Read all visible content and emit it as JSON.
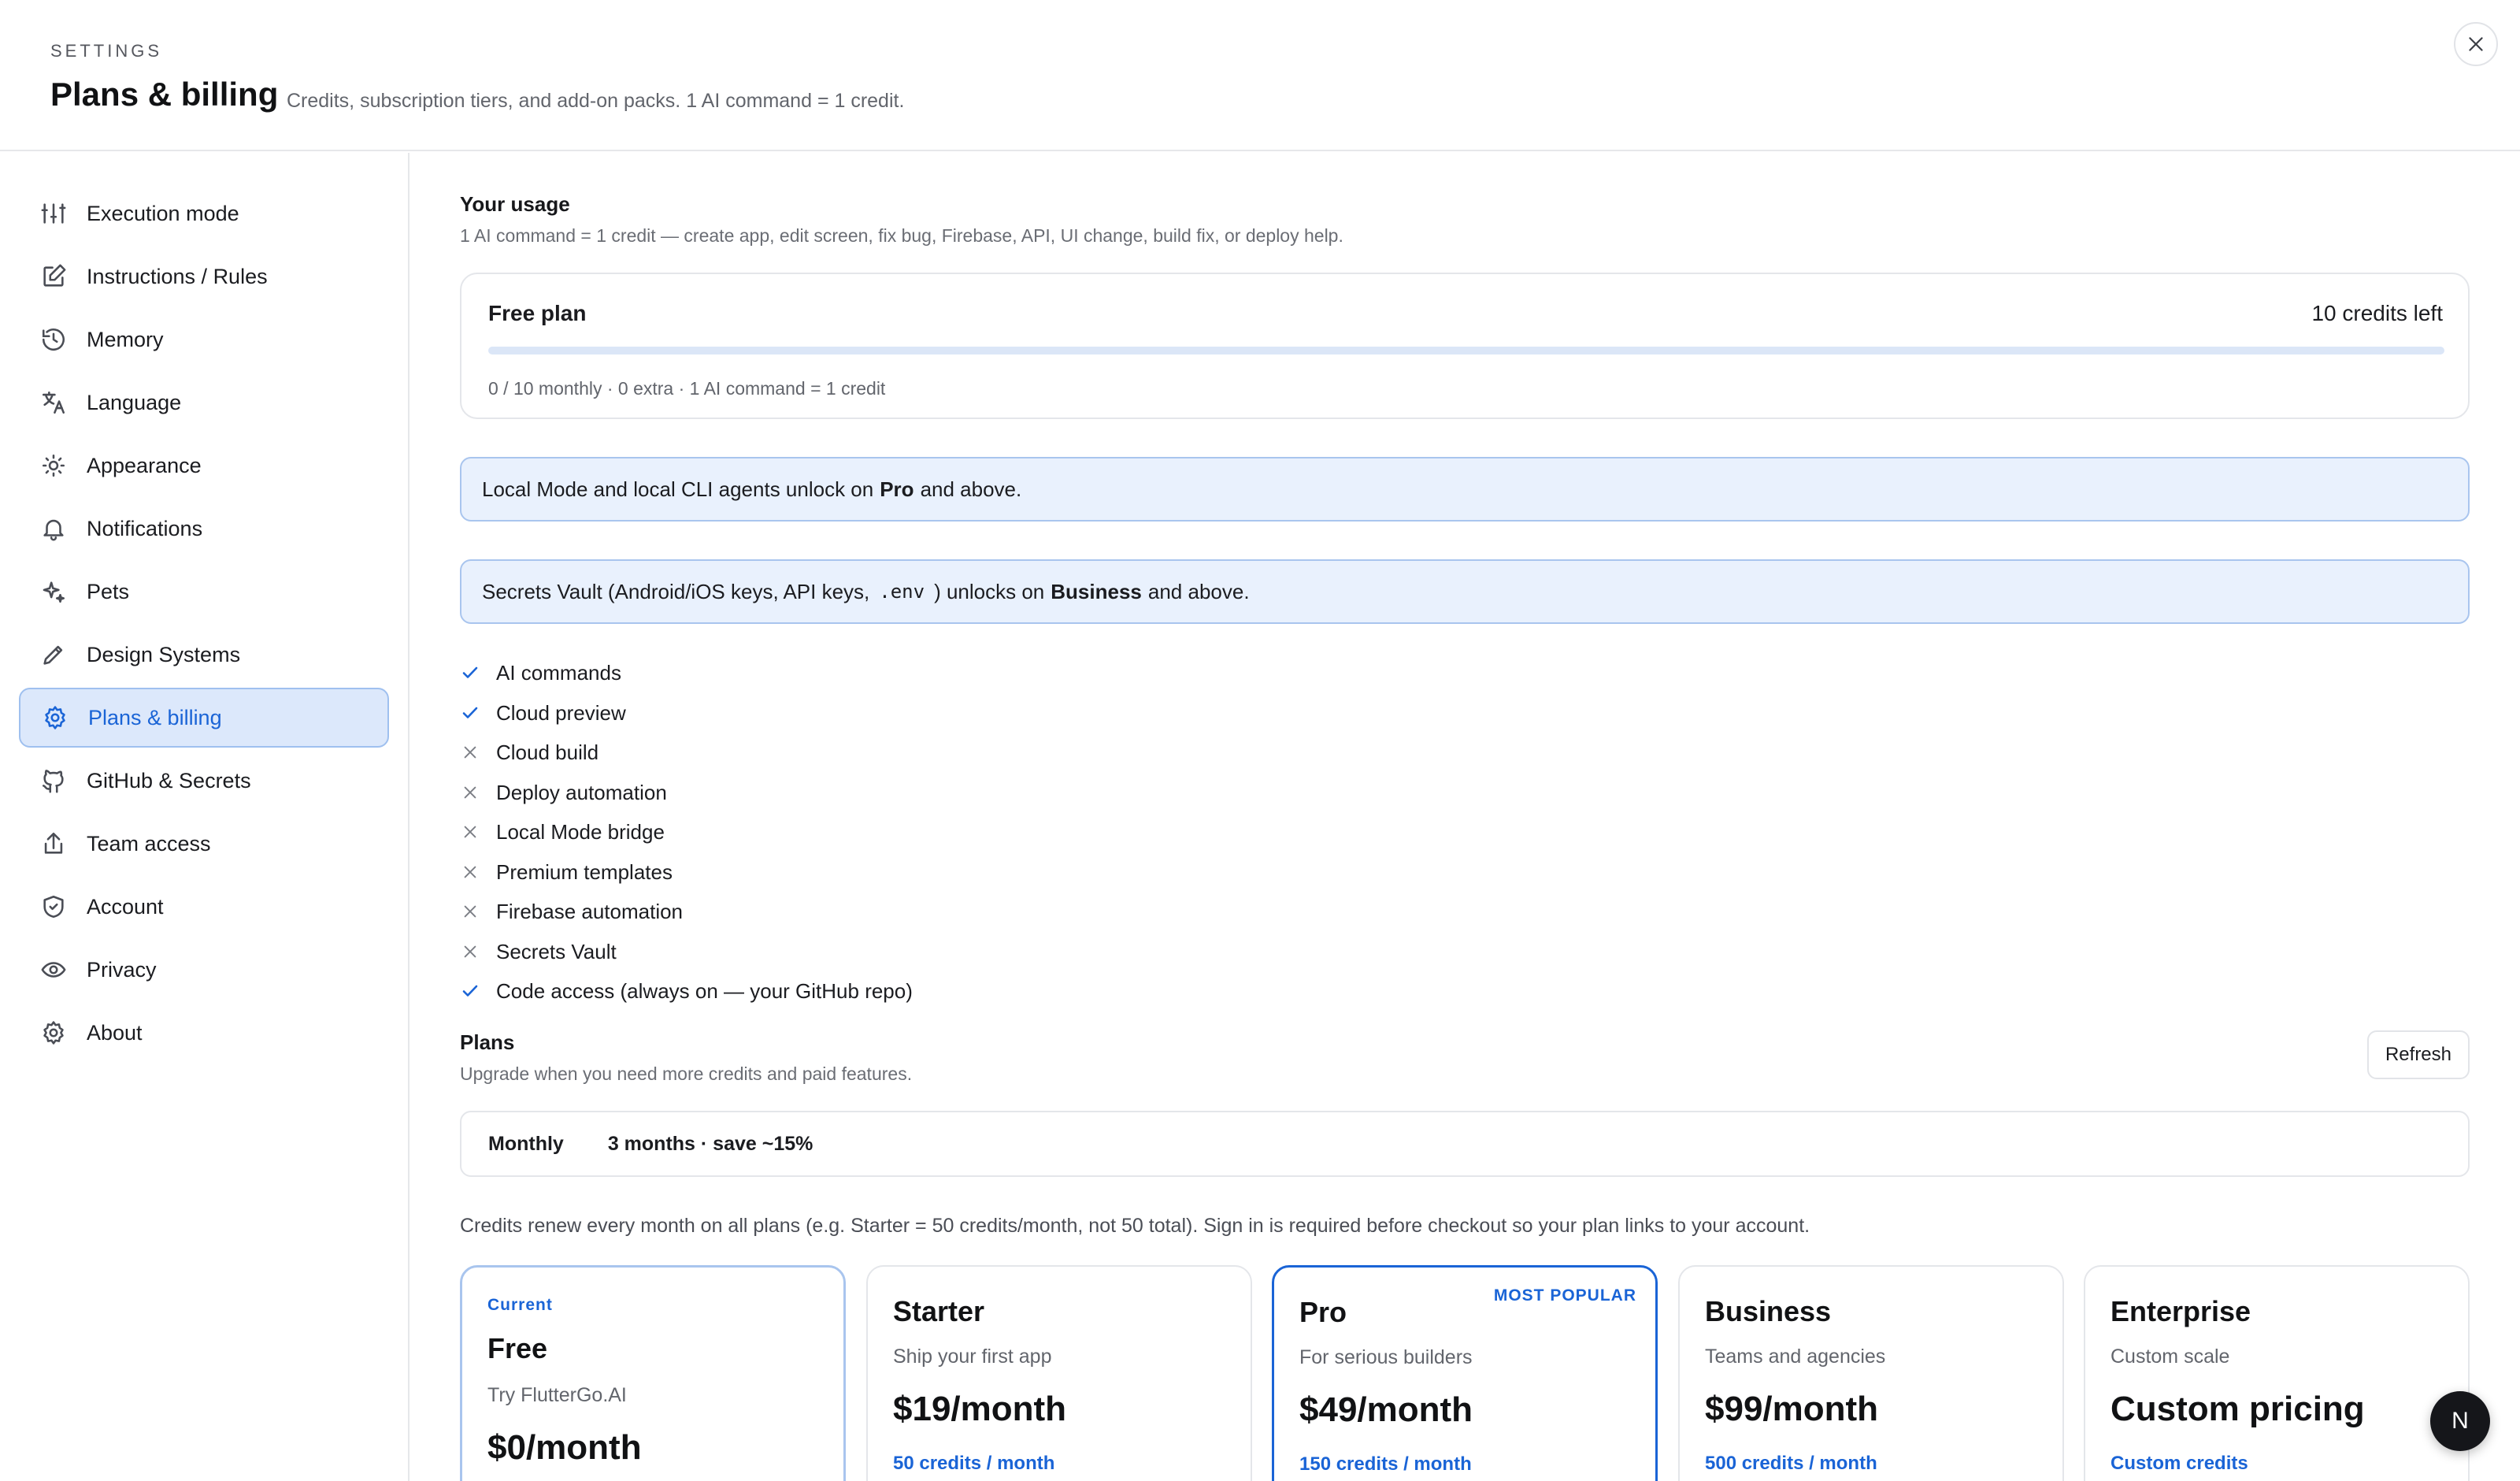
{
  "header": {
    "eyebrow": "SETTINGS",
    "title": "Plans & billing",
    "subtitle": "Credits, subscription tiers, and add-on packs. 1 AI command = 1 credit."
  },
  "sidebar": {
    "items": [
      {
        "label": "Execution mode",
        "icon": "sliders-icon"
      },
      {
        "label": "Instructions / Rules",
        "icon": "edit-icon"
      },
      {
        "label": "Memory",
        "icon": "history-icon"
      },
      {
        "label": "Language",
        "icon": "translate-icon"
      },
      {
        "label": "Appearance",
        "icon": "sun-icon"
      },
      {
        "label": "Notifications",
        "icon": "bell-icon"
      },
      {
        "label": "Pets",
        "icon": "sparkle-icon"
      },
      {
        "label": "Design Systems",
        "icon": "pencil-icon"
      },
      {
        "label": "Plans & billing",
        "icon": "gear-icon",
        "active": true
      },
      {
        "label": "GitHub & Secrets",
        "icon": "github-icon"
      },
      {
        "label": "Team access",
        "icon": "share-icon"
      },
      {
        "label": "Account",
        "icon": "shield-icon"
      },
      {
        "label": "Privacy",
        "icon": "eye-icon"
      },
      {
        "label": "About",
        "icon": "gear-icon"
      }
    ]
  },
  "usage": {
    "title": "Your usage",
    "desc": "1 AI command = 1 credit — create app, edit screen, fix bug, Firebase, API, UI change, build fix, or deploy help.",
    "plan": "Free plan",
    "credits_left": "10 credits left",
    "meta": "0 / 10 monthly · 0 extra · 1 AI command = 1 credit",
    "used_fraction": 0
  },
  "notices": {
    "local": {
      "pre": "Local Mode and local CLI agents unlock on",
      "bold": "Pro",
      "post": "and above."
    },
    "vault": {
      "pre": "Secrets Vault (Android/iOS keys, API keys,",
      "code": ".env",
      "mid": ") unlocks on",
      "bold": "Business",
      "post": "and above."
    }
  },
  "features": [
    {
      "label": "AI commands",
      "enabled": true
    },
    {
      "label": "Cloud preview",
      "enabled": true
    },
    {
      "label": "Cloud build",
      "enabled": false
    },
    {
      "label": "Deploy automation",
      "enabled": false
    },
    {
      "label": "Local Mode bridge",
      "enabled": false
    },
    {
      "label": "Premium templates",
      "enabled": false
    },
    {
      "label": "Firebase automation",
      "enabled": false
    },
    {
      "label": "Secrets Vault",
      "enabled": false
    },
    {
      "label": "Code access (always on — your GitHub repo)",
      "enabled": true
    }
  ],
  "plans_section": {
    "title": "Plans",
    "desc": "Upgrade when you need more credits and paid features.",
    "refresh_label": "Refresh",
    "billing_options": [
      {
        "label": "Monthly",
        "selected": true
      },
      {
        "label": "3 months · save ~15%",
        "selected": false
      }
    ],
    "renew_note": "Credits renew every month on all plans (e.g. Starter = 50 credits/month, not 50 total). Sign in is required before checkout so your plan links to your account."
  },
  "plans": [
    {
      "badge": "Current",
      "name": "Free",
      "tagline": "Try FlutterGo.AI",
      "price": "$0/month",
      "credits": ""
    },
    {
      "badge": "",
      "name": "Starter",
      "tagline": "Ship your first app",
      "price": "$19/month",
      "credits": "50 credits / month"
    },
    {
      "badge": "MOST POPULAR",
      "name": "Pro",
      "tagline": "For serious builders",
      "price": "$49/month",
      "credits": "150 credits / month"
    },
    {
      "badge": "",
      "name": "Business",
      "tagline": "Teams and agencies",
      "price": "$99/month",
      "credits": "500 credits / month"
    },
    {
      "badge": "",
      "name": "Enterprise",
      "tagline": "Custom scale",
      "price": "Custom pricing",
      "credits": "Custom credits"
    }
  ],
  "user": {
    "avatar_initial": "N"
  },
  "colors": {
    "accent": "#1a64d6",
    "notice_bg": "#e9f1fd",
    "active_nav_bg": "#dce8fb"
  }
}
